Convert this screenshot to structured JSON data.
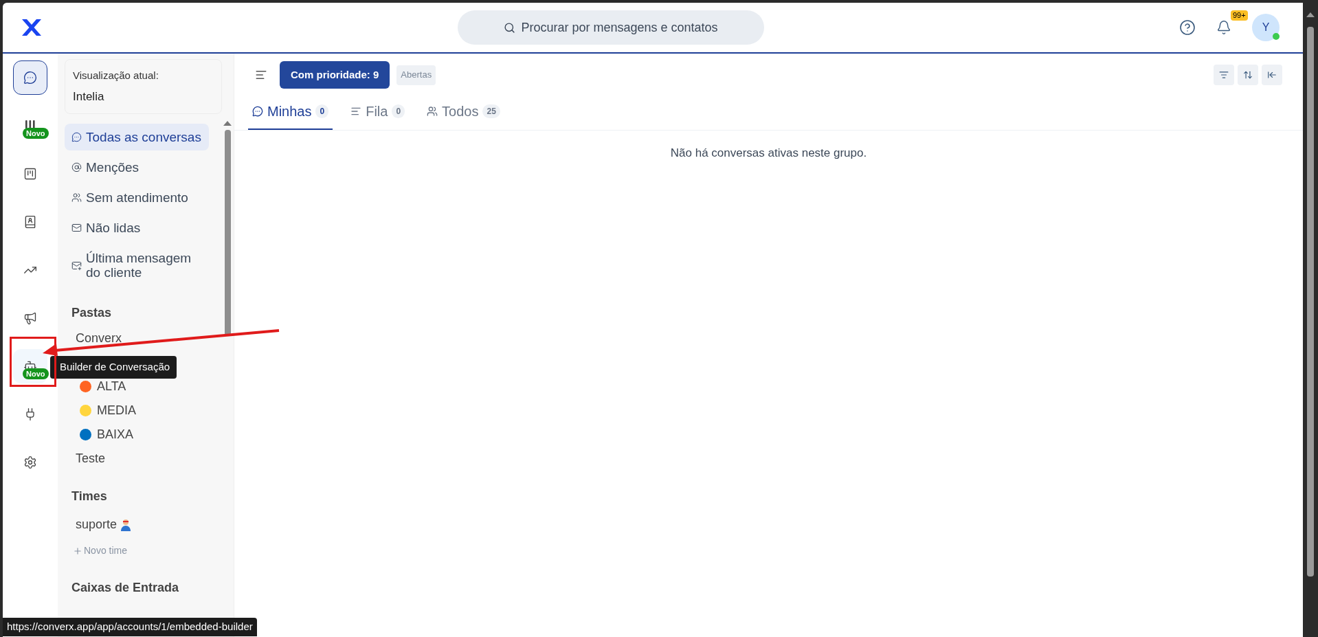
{
  "search": {
    "placeholder": "Procurar por mensagens e contatos"
  },
  "notifications": {
    "badge": "99+"
  },
  "avatar": {
    "initial": "Y",
    "online": true
  },
  "rail": [
    {
      "selected": true,
      "hovered": false
    },
    {
      "selected": false,
      "hovered": false,
      "badge": "Novo"
    },
    {
      "selected": false,
      "hovered": false
    },
    {
      "selected": false,
      "hovered": false
    },
    {
      "selected": false,
      "hovered": false
    },
    {
      "selected": false,
      "hovered": false
    },
    {
      "selected": false,
      "hovered": true,
      "badge": "Novo"
    },
    {
      "selected": false,
      "hovered": false
    },
    {
      "selected": false,
      "hovered": false
    }
  ],
  "tooltip": "Builder de Conversação",
  "current_view": {
    "label": "Visualização atual:",
    "name": "Intelia"
  },
  "views": [
    {
      "label": "Todas as conversas",
      "selected": true
    },
    {
      "label": "Menções",
      "selected": false
    },
    {
      "label": "Sem atendimento",
      "selected": false
    },
    {
      "label": "Não lidas",
      "selected": false
    },
    {
      "label": "Última mensagem do cliente",
      "selected": false
    }
  ],
  "folders": {
    "title": "Pastas",
    "items": [
      {
        "label": "Converx",
        "kind": "plain"
      },
      {
        "label": "ALTA",
        "kind": "dot",
        "color": "#ff6422"
      },
      {
        "label": "MEDIA",
        "kind": "dot",
        "color": "#ffd53d"
      },
      {
        "label": "BAIXA",
        "kind": "dot",
        "color": "#0070c0"
      },
      {
        "label": "Teste",
        "kind": "plain"
      }
    ]
  },
  "teams": {
    "title": "Times",
    "items": [
      {
        "label": "suporte"
      }
    ],
    "add": "Novo time"
  },
  "inboxes": {
    "title": "Caixas de Entrada"
  },
  "toolbar": {
    "priority_button": "Com prioridade: 9",
    "status_chip": "Abertas"
  },
  "tabs": [
    {
      "label": "Minhas",
      "count": "0",
      "selected": true
    },
    {
      "label": "Fila",
      "count": "0",
      "selected": false
    },
    {
      "label": "Todos",
      "count": "25",
      "selected": false
    }
  ],
  "empty_message": "Não há conversas ativas neste grupo.",
  "status_url": "https://converx.app/app/accounts/1/embedded-builder"
}
